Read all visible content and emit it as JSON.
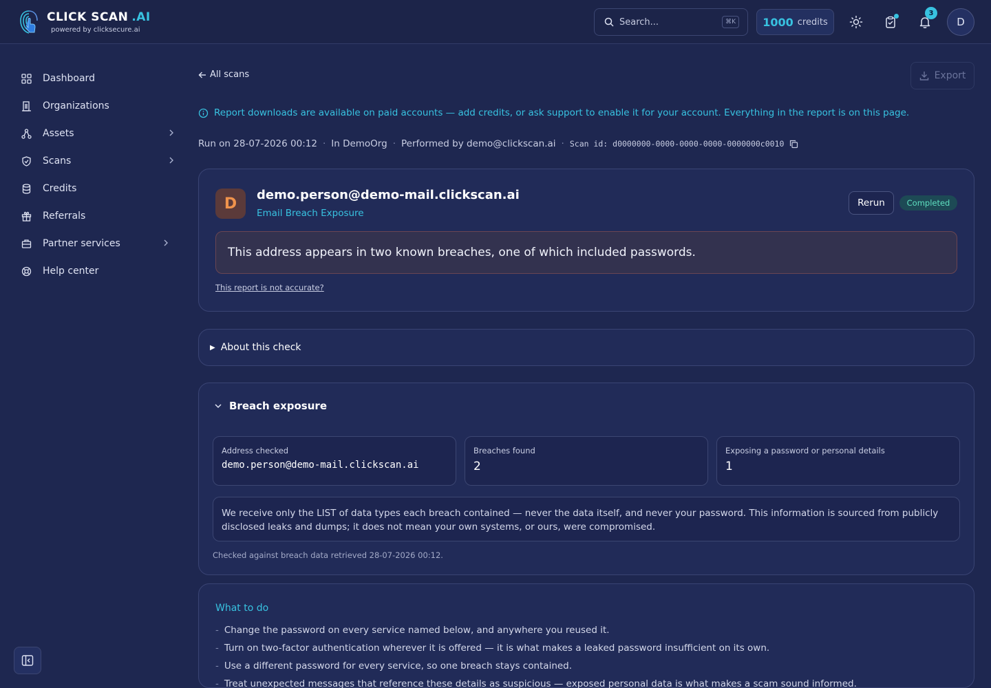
{
  "header": {
    "brand_title": "CLICK SCAN",
    "brand_suffix": ".AI",
    "brand_sub": "powered by clicksecure.ai",
    "search_placeholder": "Search...",
    "search_shortcut": "⌘K",
    "credits_value": "1000",
    "credits_label": "credits",
    "notifications_count": "3",
    "avatar_initial": "D"
  },
  "sidebar": {
    "items": [
      {
        "label": "Dashboard",
        "icon": "grid-icon"
      },
      {
        "label": "Organizations",
        "icon": "building-icon"
      },
      {
        "label": "Assets",
        "icon": "network-icon"
      },
      {
        "label": "Scans",
        "icon": "shield-icon"
      },
      {
        "label": "Credits",
        "icon": "database-icon"
      },
      {
        "label": "Referrals",
        "icon": "gift-icon"
      },
      {
        "label": "Partner services",
        "icon": "briefcase-icon"
      },
      {
        "label": "Help center",
        "icon": "lifebuoy-icon"
      }
    ]
  },
  "main": {
    "back_label": "All scans",
    "export_label": "Export",
    "notice": "Report downloads are available on paid accounts — add credits, or ask support to enable it for your account. Everything in the report is on this page.",
    "meta": {
      "run_on": "Run on 28-07-2026 00:12",
      "org": "In DemoOrg",
      "performed_by": "Performed by demo@clickscan.ai",
      "scan_id": "Scan id: d0000000-0000-0000-0000-0000000c0010"
    },
    "result": {
      "avatar_initial": "D",
      "email": "demo.person@demo-mail.clickscan.ai",
      "type": "Email Breach Exposure",
      "rerun_label": "Rerun",
      "status": "Completed",
      "summary": "This address appears in two known breaches, one of which included passwords.",
      "inaccurate_link": "This report is not accurate?"
    },
    "about_label": "About this check",
    "breach": {
      "title": "Breach exposure",
      "stats": [
        {
          "label": "Address checked",
          "value": "demo.person@demo-mail.clickscan.ai"
        },
        {
          "label": "Breaches found",
          "value": "2"
        },
        {
          "label": "Exposing a password or personal details",
          "value": "1"
        }
      ],
      "note": "We receive only the LIST of data types each breach contained — never the data itself, and never your password. This information is sourced from publicly disclosed leaks and dumps; it does not mean your own systems, or ours, were compromised.",
      "checked": "Checked against breach data retrieved 28-07-2026 00:12."
    },
    "todo": {
      "title": "What to do",
      "items": [
        "Change the password on every service named below, and anywhere you reused it.",
        "Turn on two-factor authentication wherever it is offered — it is what makes a leaked password insufficient on its own.",
        "Use a different password for every service, so one breach stays contained.",
        "Treat unexpected messages that reference these details as suspicious — exposed personal data is what makes a scam sound informed."
      ]
    }
  },
  "colors": {
    "background": "#1e2750",
    "accent": "#38c2e0",
    "status_completed": "#5fe0c0"
  }
}
